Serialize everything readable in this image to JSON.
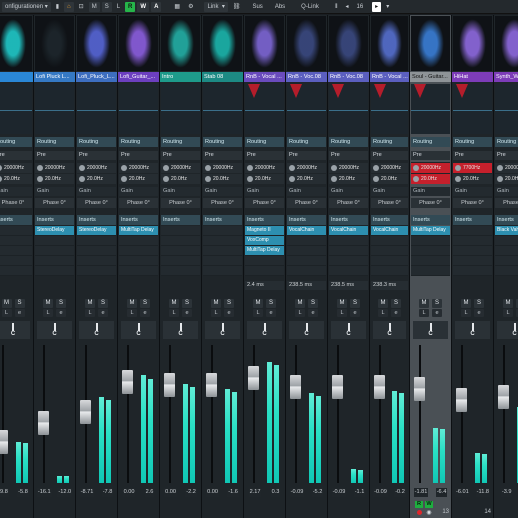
{
  "toolbar": {
    "configs_label": "onfigurationen",
    "m_label": "M",
    "s_label": "S",
    "l_label": "L",
    "r_label": "R",
    "w_label": "W",
    "a_label": "A",
    "link_label": "Link",
    "sus_label": "Sus",
    "abs_label": "Abs",
    "qlink_label": "Q-Link",
    "count_value": "16"
  },
  "channels": [
    {
      "name": "p",
      "color": "#2a87d6",
      "pic_color": "#20c9c9",
      "routing": "Routing",
      "pre": "Pre",
      "f1": "20000Hz",
      "f2": "20.0Hz",
      "gain": "Gain",
      "phase": "Phase 0°",
      "inserts": "Inserts",
      "slots": [],
      "delay": "",
      "pan": "C",
      "val1": "-9.8",
      "val2": "-5.8",
      "num": "",
      "meter": 0.3,
      "fader": 0.25,
      "selected": false
    },
    {
      "name": "Lofi Pluck L...",
      "color": "#3579c4",
      "pic_color": "#1d262c",
      "routing": "Routing",
      "pre": "Pre",
      "f1": "20000Hz",
      "f2": "20.0Hz",
      "gain": "Gain",
      "phase": "Phase 0°",
      "inserts": "Inserts",
      "slots": [
        "StereoDelay"
      ],
      "delay": "",
      "pan": "C",
      "val1": "-16.1",
      "val2": "-12.0",
      "num": "",
      "meter": 0.05,
      "fader": 0.42,
      "selected": false
    },
    {
      "name": "Lofi_Pluck_L...",
      "color": "#3d6ec0",
      "pic_color": "#5766d8",
      "routing": "Routing",
      "pre": "Pre",
      "f1": "20000Hz",
      "f2": "20.0Hz",
      "gain": "Gain",
      "phase": "Phase 0°",
      "inserts": "Inserts",
      "slots": [
        "StereoDelay"
      ],
      "delay": "",
      "pan": "C",
      "val1": "-8.71",
      "val2": "-7.8",
      "num": "",
      "meter": 0.62,
      "fader": 0.52,
      "selected": false
    },
    {
      "name": "Lofi_Guitar_...",
      "color": "#6c3fbf",
      "pic_color": "#8c5fe0",
      "routing": "Routing",
      "pre": "Pre",
      "f1": "20000Hz",
      "f2": "20.0Hz",
      "gain": "Gain",
      "phase": "Phase 0°",
      "inserts": "Inserts",
      "slots": [
        "MultiTap Delay"
      ],
      "delay": "",
      "pan": "C",
      "val1": "0.00",
      "val2": "2.6",
      "num": "",
      "meter": 0.78,
      "fader": 0.78,
      "selected": false
    },
    {
      "name": "Intro",
      "color": "#1e9b8b",
      "pic_color": "#23b0a6",
      "routing": "Routing",
      "pre": "Pre",
      "f1": "20000Hz",
      "f2": "20.0Hz",
      "gain": "Gain",
      "phase": "Phase 0°",
      "inserts": "Inserts",
      "slots": [],
      "delay": "",
      "pan": "C",
      "val1": "0.00",
      "val2": "-2.2",
      "num": "",
      "meter": 0.72,
      "fader": 0.75,
      "selected": false
    },
    {
      "name": "Stab 08",
      "color": "#1d8a84",
      "pic_color": "#1bb6ad",
      "routing": "Routing",
      "pre": "Pre",
      "f1": "20000Hz",
      "f2": "20.0Hz",
      "gain": "Gain",
      "phase": "Phase 0°",
      "inserts": "Inserts",
      "slots": [],
      "delay": "",
      "pan": "C",
      "val1": "0.00",
      "val2": "-1.6",
      "num": "",
      "meter": 0.68,
      "fader": 0.75,
      "selected": false
    },
    {
      "name": "RnB - Vocal ...",
      "color": "#6a4bbd",
      "pic_color": "#7e67d6",
      "routing": "Routing",
      "pre": "Pre",
      "f1": "20000Hz",
      "f2": "20.0Hz",
      "gain": "Gain",
      "phase": "Phase 0°",
      "inserts": "Inserts",
      "slots": [
        "Magneto II",
        "VoxComp",
        "MultiTap Delay"
      ],
      "delay": "2.4 ms",
      "pan": "C",
      "val1": "2.17",
      "val2": "0.3",
      "num": "",
      "meter": 0.88,
      "fader": 0.82,
      "selected": false
    },
    {
      "name": "RnB - Voc.08",
      "color": "#5b5fbf",
      "pic_color": "#3b4a82",
      "routing": "Routing",
      "pre": "Pre",
      "f1": "20000Hz",
      "f2": "20.0Hz",
      "gain": "Gain",
      "phase": "Phase 0°",
      "inserts": "Inserts",
      "slots": [
        "VocalChain"
      ],
      "delay": "238.5 ms",
      "pan": "C",
      "val1": "-0.09",
      "val2": "-5.2",
      "num": "",
      "meter": 0.65,
      "fader": 0.74,
      "selected": false
    },
    {
      "name": "RnB - Voc.08",
      "color": "#5b5fbf",
      "pic_color": "#3b4a82",
      "routing": "Routing",
      "pre": "Pre",
      "f1": "20000Hz",
      "f2": "20.0Hz",
      "gain": "Gain",
      "phase": "Phase 0°",
      "inserts": "Inserts",
      "slots": [
        "VocalChain"
      ],
      "delay": "238.5 ms",
      "pan": "C",
      "val1": "-0.09",
      "val2": "-1.1",
      "num": "",
      "meter": 0.1,
      "fader": 0.74,
      "selected": false
    },
    {
      "name": "RnB - Vocal ...",
      "color": "#5b5fbf",
      "pic_color": "#5670d0",
      "routing": "Routing",
      "pre": "Pre",
      "f1": "20000Hz",
      "f2": "20.0Hz",
      "gain": "Gain",
      "phase": "Phase 0°",
      "inserts": "Inserts",
      "slots": [
        "VocalChain"
      ],
      "delay": "238.3 ms",
      "pan": "C",
      "val1": "-0.09",
      "val2": "-0.2",
      "num": "",
      "meter": 0.67,
      "fader": 0.74,
      "selected": false
    },
    {
      "name": "Soul - Guitar...",
      "color": "#5f6367",
      "pic_color": "#3a7fd8",
      "routing": "Routing",
      "pre": "Pre",
      "f1": "20000Hz",
      "f2": "20.0Hz",
      "gain": "Gain",
      "phase": "Phase 0°",
      "inserts": "Inserts",
      "slots": [
        "MultiTap Delay"
      ],
      "delay": "",
      "pan": "C",
      "val1": "-1.81",
      "val2": "-6.4",
      "num": "13",
      "meter": 0.4,
      "fader": 0.72,
      "selected": true
    },
    {
      "name": "HiHat",
      "color": "#7d3cb8",
      "pic_color": "#8f6ae0",
      "routing": "Routing",
      "pre": "Pre",
      "f1": "7700Hz",
      "f2": "20.0Hz",
      "gain": "Gain",
      "phase": "Phase 0°",
      "inserts": "Inserts",
      "slots": [],
      "delay": "",
      "pan": "C",
      "val1": "-6.01",
      "val2": "-11.8",
      "num": "14",
      "meter": 0.22,
      "fader": 0.62,
      "selected": false
    },
    {
      "name": "Synth_Wi...",
      "color": "#7d3cb8",
      "pic_color": "#8f6ae0",
      "routing": "Routing",
      "pre": "Pre",
      "f1": "20000Hz",
      "f2": "20.0Hz",
      "gain": "Gain",
      "phase": "Phase 0°",
      "inserts": "Inserts",
      "slots": [
        "Black Valve"
      ],
      "delay": "",
      "pan": "C",
      "val1": "-3.9",
      "val2": "",
      "num": "",
      "meter": 0.55,
      "fader": 0.65,
      "selected": false
    }
  ]
}
